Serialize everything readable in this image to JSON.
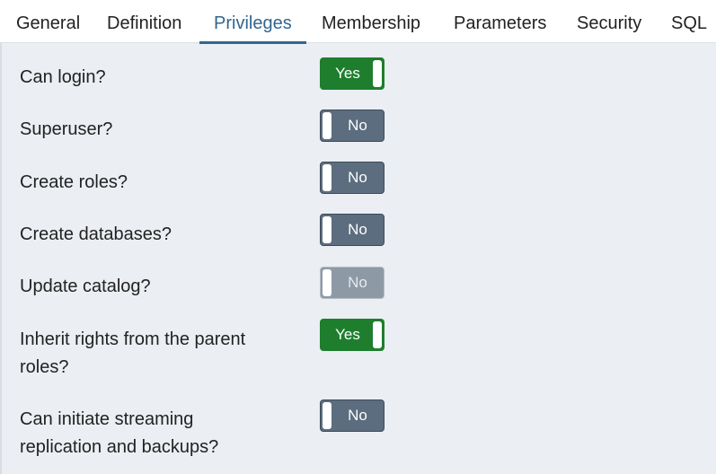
{
  "tabs": [
    {
      "label": "General"
    },
    {
      "label": "Definition"
    },
    {
      "label": "Privileges",
      "active": true
    },
    {
      "label": "Membership"
    },
    {
      "label": "Parameters"
    },
    {
      "label": "Security"
    },
    {
      "label": "SQL"
    }
  ],
  "privileges": [
    {
      "label": "Can login?",
      "value": "Yes"
    },
    {
      "label": "Superuser?",
      "value": "No"
    },
    {
      "label": "Create roles?",
      "value": "No"
    },
    {
      "label": "Create databases?",
      "value": "No"
    },
    {
      "label": "Update catalog?",
      "value": "No",
      "disabled": true
    },
    {
      "label_line1": "Inherit rights from the parent",
      "label_line2": "roles?",
      "value": "Yes"
    },
    {
      "label_line1": "Can initiate streaming",
      "label_line2": "replication and backups?",
      "value": "No"
    }
  ],
  "colors": {
    "accent": "#326690",
    "toggle_on": "#1e7e2e",
    "toggle_off": "#5b6d7e",
    "toggle_disabled": "#8d9aa6"
  }
}
